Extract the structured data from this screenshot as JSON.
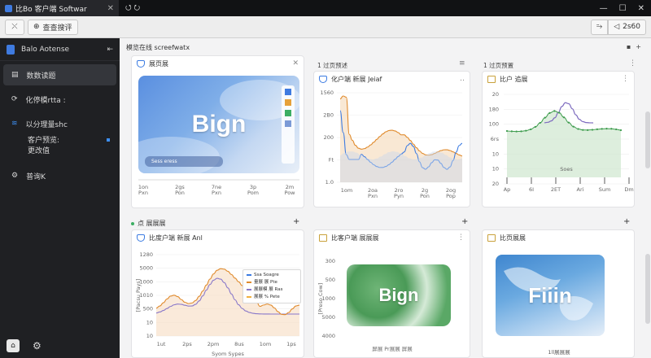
{
  "window": {
    "title": "比Bo 客户端 Softwar",
    "tab_extra": "⭯ ⭮"
  },
  "toolbar": {
    "left_icon": "⤬",
    "view_report": "查查搜评",
    "right_a": "⥲",
    "right_b": "2s60"
  },
  "sidebar": {
    "header": "Balo Aotense",
    "header_right": "⇤",
    "items": [
      {
        "label": "数数读题",
        "icon": "document-icon",
        "active": true
      },
      {
        "label": "化停模rtta :",
        "icon": "refresh-icon",
        "active": false
      },
      {
        "label": "以分理量shc",
        "icon": "wifi-icon",
        "active": false
      },
      {
        "label": "普询K",
        "icon": "gear-icon",
        "active": false
      }
    ],
    "sub_lines": [
      "客户预览:",
      "更改值"
    ]
  },
  "main": {
    "section1_title": "模览在线 screefwatx",
    "section2_title": "点 展展展",
    "cards": {
      "c1": {
        "title": "展页展"
      },
      "c2": {
        "top_label": "1 过页预述",
        "title": "化户端 新展 Jeiaf"
      },
      "c3": {
        "top_label": "1 过页预置",
        "title": "比户 追展"
      },
      "c4": {
        "title": "比度户端 新展 Anl"
      },
      "c5": {
        "title": "比客户端 展展展"
      },
      "c6": {
        "title": "比页展展"
      }
    }
  },
  "charts": {
    "c1": {
      "image_text": "Bign",
      "caption": "Sess eress",
      "xticks": [
        "1on\nPxn",
        "2gs\nPon",
        "7ne\nPxn",
        "3p\nPom",
        "2m\nPow"
      ]
    },
    "c2": {
      "yticks": [
        "1560",
        "2B0",
        "200",
        "Ft",
        "1.0"
      ],
      "xticks": [
        "1om",
        "2oa\nPxn",
        "2ro\nPyn",
        "2g\nPon",
        "2og\nPop"
      ]
    },
    "c3": {
      "yticks": [
        "20",
        "180",
        "100",
        "6rs",
        "10",
        "10",
        "20"
      ],
      "xticks": [
        "Ap",
        "6I",
        "2ET",
        "Ari",
        "Sum",
        "Dm"
      ],
      "center_label": "Soes"
    },
    "c4": {
      "yticks": [
        "1280",
        "5000",
        "1000",
        "1010",
        "500",
        "10",
        "10"
      ],
      "xticks": [
        "1ut",
        "2ps",
        "2pm",
        "8us",
        "1om",
        "1ps"
      ],
      "ylabel": "[Pacsu Pays]",
      "xlabel": "Syom Sypes",
      "legend": [
        "Ssa Soagre",
        "量展 展 Pte",
        "展展模 展 Ras",
        "展展 % Pete"
      ]
    },
    "c5": {
      "image_text": "Bign",
      "yticks": [
        "300",
        "500",
        "1000",
        "5000",
        "4000"
      ],
      "ylabel": "[Preso Cow]",
      "xlabel": "屏展 Pr展展 屏展"
    },
    "c6": {
      "image_text": "Fiiin",
      "xlabel": "1ll展展展"
    }
  }
}
